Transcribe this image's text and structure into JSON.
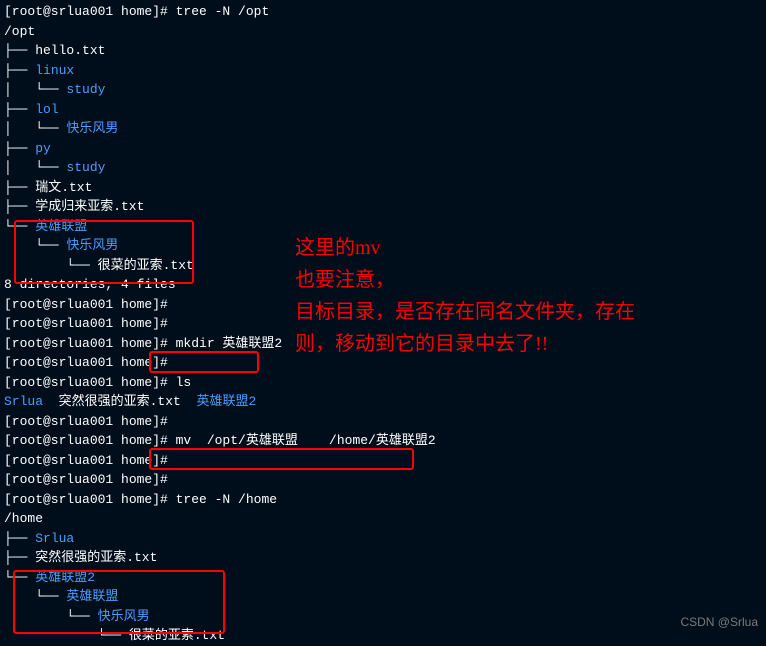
{
  "prompt_host": "root@srlua001",
  "prompt_path": "home",
  "lines": {
    "l0": "[root@srlua001 home]# tree -N /opt",
    "l1": "/opt",
    "l2": "├── hello.txt",
    "l3": "├── linux",
    "l4": "│   └── study",
    "l5": "├── lol",
    "l6": "│   └── 快乐风男",
    "l7": "├── py",
    "l8": "│   └── study",
    "l9": "├── 瑞文.txt",
    "l10": "├── 学成归来亚索.txt",
    "l11": "└── 英雄联盟",
    "l12": "    └── 快乐风男",
    "l13": "        └── 很菜的亚索.txt",
    "l14": "",
    "l15": "8 directories, 4 files",
    "l16": "[root@srlua001 home]#",
    "l17": "[root@srlua001 home]#",
    "l18": "[root@srlua001 home]# mkdir 英雄联盟2",
    "l18_cmd": " mkdir 英雄联盟2",
    "l19": "[root@srlua001 home]#",
    "l20": "[root@srlua001 home]# ls",
    "l21a": "Srlua",
    "l21b": "  突然很强的亚索.txt  ",
    "l21c": "英雄联盟2",
    "l22": "[root@srlua001 home]#",
    "l23": "[root@srlua001 home]# mv  /opt/英雄联盟    /home/英雄联盟2",
    "l23_cmd": " mv  /opt/英雄联盟    /home/英雄联盟2",
    "l24": "[root@srlua001 home]#",
    "l25": "[root@srlua001 home]#",
    "l26": "[root@srlua001 home]# tree -N /home",
    "l27": "/home",
    "l28": "├── Srlua",
    "l29": "├── 突然很强的亚索.txt",
    "l30": "└── 英雄联盟2",
    "l31": "    └── 英雄联盟",
    "l32": "        └── 快乐风男",
    "l33": "            └── 很菜的亚索.txt"
  },
  "annotation": {
    "text1": "这里的mv",
    "text2": "也要注意，",
    "text3": "目标目录，是否存在同名文件夹，存在",
    "text4": "则，移动到它的目录中去了!!"
  },
  "watermark": "CSDN @Srlua"
}
